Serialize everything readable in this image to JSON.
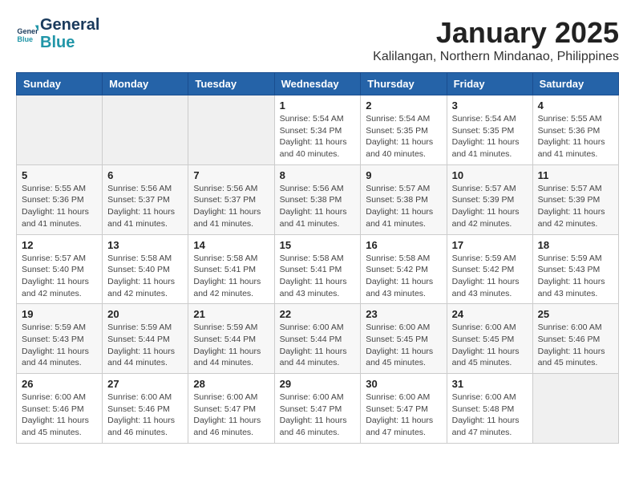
{
  "header": {
    "logo_line1": "General",
    "logo_line2": "Blue",
    "title": "January 2025",
    "subtitle": "Kalilangan, Northern Mindanao, Philippines"
  },
  "weekdays": [
    "Sunday",
    "Monday",
    "Tuesday",
    "Wednesday",
    "Thursday",
    "Friday",
    "Saturday"
  ],
  "weeks": [
    [
      {
        "day": "",
        "sunrise": "",
        "sunset": "",
        "daylight": ""
      },
      {
        "day": "",
        "sunrise": "",
        "sunset": "",
        "daylight": ""
      },
      {
        "day": "",
        "sunrise": "",
        "sunset": "",
        "daylight": ""
      },
      {
        "day": "1",
        "sunrise": "Sunrise: 5:54 AM",
        "sunset": "Sunset: 5:34 PM",
        "daylight": "Daylight: 11 hours and 40 minutes."
      },
      {
        "day": "2",
        "sunrise": "Sunrise: 5:54 AM",
        "sunset": "Sunset: 5:35 PM",
        "daylight": "Daylight: 11 hours and 40 minutes."
      },
      {
        "day": "3",
        "sunrise": "Sunrise: 5:54 AM",
        "sunset": "Sunset: 5:35 PM",
        "daylight": "Daylight: 11 hours and 41 minutes."
      },
      {
        "day": "4",
        "sunrise": "Sunrise: 5:55 AM",
        "sunset": "Sunset: 5:36 PM",
        "daylight": "Daylight: 11 hours and 41 minutes."
      }
    ],
    [
      {
        "day": "5",
        "sunrise": "Sunrise: 5:55 AM",
        "sunset": "Sunset: 5:36 PM",
        "daylight": "Daylight: 11 hours and 41 minutes."
      },
      {
        "day": "6",
        "sunrise": "Sunrise: 5:56 AM",
        "sunset": "Sunset: 5:37 PM",
        "daylight": "Daylight: 11 hours and 41 minutes."
      },
      {
        "day": "7",
        "sunrise": "Sunrise: 5:56 AM",
        "sunset": "Sunset: 5:37 PM",
        "daylight": "Daylight: 11 hours and 41 minutes."
      },
      {
        "day": "8",
        "sunrise": "Sunrise: 5:56 AM",
        "sunset": "Sunset: 5:38 PM",
        "daylight": "Daylight: 11 hours and 41 minutes."
      },
      {
        "day": "9",
        "sunrise": "Sunrise: 5:57 AM",
        "sunset": "Sunset: 5:38 PM",
        "daylight": "Daylight: 11 hours and 41 minutes."
      },
      {
        "day": "10",
        "sunrise": "Sunrise: 5:57 AM",
        "sunset": "Sunset: 5:39 PM",
        "daylight": "Daylight: 11 hours and 42 minutes."
      },
      {
        "day": "11",
        "sunrise": "Sunrise: 5:57 AM",
        "sunset": "Sunset: 5:39 PM",
        "daylight": "Daylight: 11 hours and 42 minutes."
      }
    ],
    [
      {
        "day": "12",
        "sunrise": "Sunrise: 5:57 AM",
        "sunset": "Sunset: 5:40 PM",
        "daylight": "Daylight: 11 hours and 42 minutes."
      },
      {
        "day": "13",
        "sunrise": "Sunrise: 5:58 AM",
        "sunset": "Sunset: 5:40 PM",
        "daylight": "Daylight: 11 hours and 42 minutes."
      },
      {
        "day": "14",
        "sunrise": "Sunrise: 5:58 AM",
        "sunset": "Sunset: 5:41 PM",
        "daylight": "Daylight: 11 hours and 42 minutes."
      },
      {
        "day": "15",
        "sunrise": "Sunrise: 5:58 AM",
        "sunset": "Sunset: 5:41 PM",
        "daylight": "Daylight: 11 hours and 43 minutes."
      },
      {
        "day": "16",
        "sunrise": "Sunrise: 5:58 AM",
        "sunset": "Sunset: 5:42 PM",
        "daylight": "Daylight: 11 hours and 43 minutes."
      },
      {
        "day": "17",
        "sunrise": "Sunrise: 5:59 AM",
        "sunset": "Sunset: 5:42 PM",
        "daylight": "Daylight: 11 hours and 43 minutes."
      },
      {
        "day": "18",
        "sunrise": "Sunrise: 5:59 AM",
        "sunset": "Sunset: 5:43 PM",
        "daylight": "Daylight: 11 hours and 43 minutes."
      }
    ],
    [
      {
        "day": "19",
        "sunrise": "Sunrise: 5:59 AM",
        "sunset": "Sunset: 5:43 PM",
        "daylight": "Daylight: 11 hours and 44 minutes."
      },
      {
        "day": "20",
        "sunrise": "Sunrise: 5:59 AM",
        "sunset": "Sunset: 5:44 PM",
        "daylight": "Daylight: 11 hours and 44 minutes."
      },
      {
        "day": "21",
        "sunrise": "Sunrise: 5:59 AM",
        "sunset": "Sunset: 5:44 PM",
        "daylight": "Daylight: 11 hours and 44 minutes."
      },
      {
        "day": "22",
        "sunrise": "Sunrise: 6:00 AM",
        "sunset": "Sunset: 5:44 PM",
        "daylight": "Daylight: 11 hours and 44 minutes."
      },
      {
        "day": "23",
        "sunrise": "Sunrise: 6:00 AM",
        "sunset": "Sunset: 5:45 PM",
        "daylight": "Daylight: 11 hours and 45 minutes."
      },
      {
        "day": "24",
        "sunrise": "Sunrise: 6:00 AM",
        "sunset": "Sunset: 5:45 PM",
        "daylight": "Daylight: 11 hours and 45 minutes."
      },
      {
        "day": "25",
        "sunrise": "Sunrise: 6:00 AM",
        "sunset": "Sunset: 5:46 PM",
        "daylight": "Daylight: 11 hours and 45 minutes."
      }
    ],
    [
      {
        "day": "26",
        "sunrise": "Sunrise: 6:00 AM",
        "sunset": "Sunset: 5:46 PM",
        "daylight": "Daylight: 11 hours and 45 minutes."
      },
      {
        "day": "27",
        "sunrise": "Sunrise: 6:00 AM",
        "sunset": "Sunset: 5:46 PM",
        "daylight": "Daylight: 11 hours and 46 minutes."
      },
      {
        "day": "28",
        "sunrise": "Sunrise: 6:00 AM",
        "sunset": "Sunset: 5:47 PM",
        "daylight": "Daylight: 11 hours and 46 minutes."
      },
      {
        "day": "29",
        "sunrise": "Sunrise: 6:00 AM",
        "sunset": "Sunset: 5:47 PM",
        "daylight": "Daylight: 11 hours and 46 minutes."
      },
      {
        "day": "30",
        "sunrise": "Sunrise: 6:00 AM",
        "sunset": "Sunset: 5:47 PM",
        "daylight": "Daylight: 11 hours and 47 minutes."
      },
      {
        "day": "31",
        "sunrise": "Sunrise: 6:00 AM",
        "sunset": "Sunset: 5:48 PM",
        "daylight": "Daylight: 11 hours and 47 minutes."
      },
      {
        "day": "",
        "sunrise": "",
        "sunset": "",
        "daylight": ""
      }
    ]
  ]
}
